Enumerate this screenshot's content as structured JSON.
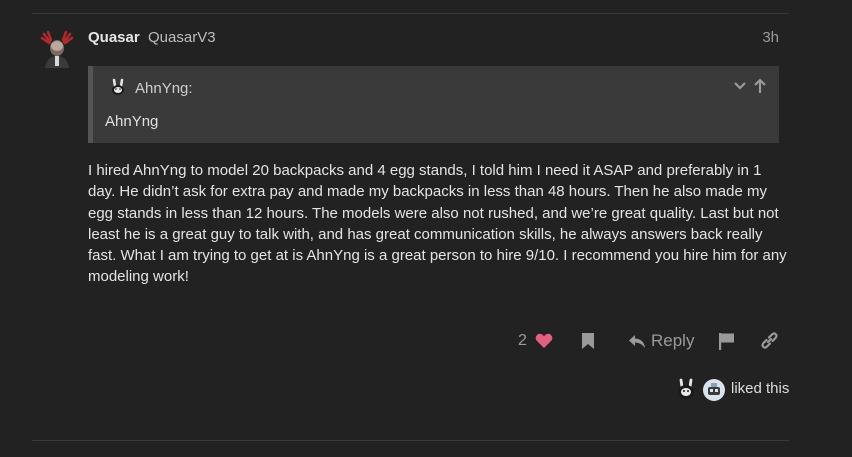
{
  "post": {
    "username": "Quasar",
    "full_name": "QuasarV3",
    "date": "3h",
    "quote": {
      "author": "AhnYng:",
      "body": "AhnYng"
    },
    "body": "I hired AhnYng to model 20 backpacks and 4 egg stands, I told him I need it ASAP and preferably in 1 day. He didn’t ask for extra pay and made my backpacks in less than 48 hours. Then he also made my egg stands in less than 12 hours. The models were also not rushed, and we’re great quality. Last but not least he is a great guy to talk with, and has great communication skills, he always answers back really fast. What I am trying to get at is AhnYng is a great person to hire 9/10. I recommend you hire him for any modeling work!"
  },
  "actions": {
    "like_count": "2",
    "reply_label": "Reply"
  },
  "likes": {
    "text": "liked this"
  },
  "colors": {
    "background": "#222222",
    "quote_background": "#3a3a3a",
    "heart": "#e45d82",
    "muted": "#9a9a9a"
  },
  "icons": [
    "heart-icon",
    "bookmark-icon",
    "reply-icon",
    "flag-icon",
    "link-icon",
    "chevron-down-icon",
    "arrow-up-icon"
  ]
}
